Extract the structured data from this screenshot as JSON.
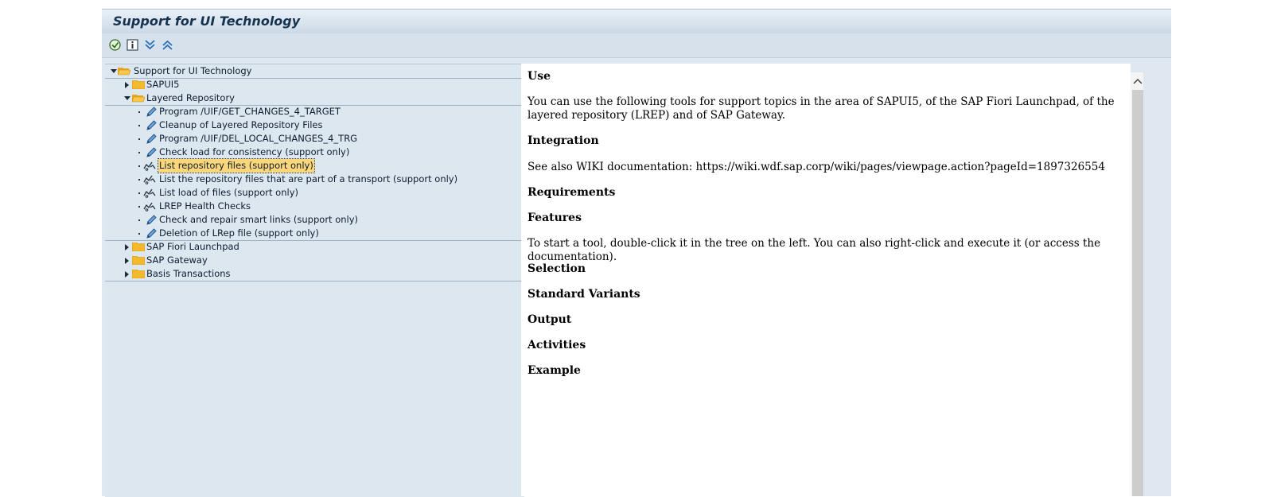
{
  "window": {
    "title": "Support for UI Technology"
  },
  "toolbar": {
    "buttons": [
      {
        "name": "execute-icon"
      },
      {
        "name": "info-icon"
      },
      {
        "name": "expand-all-icon"
      },
      {
        "name": "collapse-all-icon"
      }
    ]
  },
  "tree": {
    "root": "Support for UI Technology",
    "sapui5": "SAPUI5",
    "layered_repository": "Layered Repository",
    "items": [
      "Program /UIF/GET_CHANGES_4_TARGET",
      "Cleanup of Layered Repository Files",
      "Program /UIF/DEL_LOCAL_CHANGES_4_TRG",
      "Check load for consistency (support only)",
      "List repository files (support only)",
      "List the repository files that are part of a transport (support only)",
      "List load of files (support only)",
      "LREP Health Checks",
      "Check and repair smart links (support only)",
      "Deletion of LRep file (support only)"
    ],
    "fiori": "SAP Fiori Launchpad",
    "gateway": "SAP Gateway",
    "basis": "Basis Transactions",
    "selected_index": 4
  },
  "doc": {
    "use_heading": "Use",
    "use_text": "You can use the following tools for support topics in the area of SAPUI5, of the SAP Fiori Launchpad, of the layered repository (LREP) and of SAP Gateway.",
    "integration_heading": "Integration",
    "integration_text": "See also WIKI documentation: https://wiki.wdf.sap.corp/wiki/pages/viewpage.action?pageId=1897326554",
    "requirements_heading": "Requirements",
    "features_heading": "Features",
    "features_text": "To start a tool, double-click it in the tree on the left. You can also right-click and execute it (or access the documentation).",
    "selection_heading": "Selection",
    "variants_heading": "Standard Variants",
    "output_heading": "Output",
    "activities_heading": "Activities",
    "example_heading": "Example"
  }
}
